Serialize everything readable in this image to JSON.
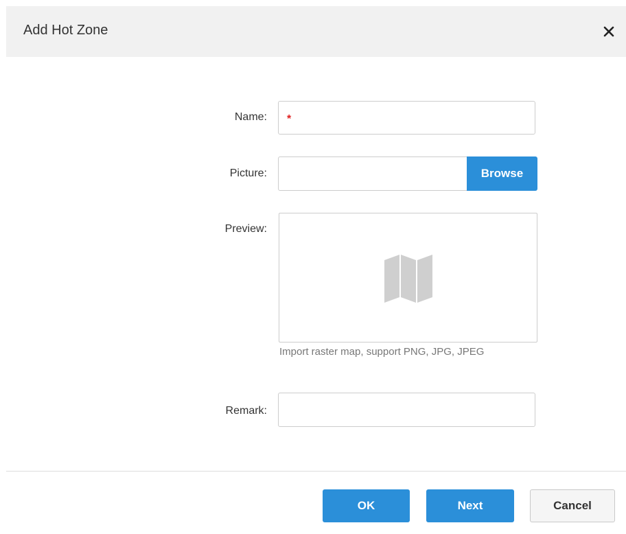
{
  "dialog": {
    "title": "Add Hot Zone",
    "close_icon": "close-icon"
  },
  "form": {
    "name": {
      "label": "Name:",
      "value": "",
      "required_marker": "*"
    },
    "picture": {
      "label": "Picture:",
      "value": "",
      "browse_label": "Browse"
    },
    "preview": {
      "label": "Preview:",
      "placeholder_icon": "map-icon",
      "hint": "Import raster map, support PNG, JPG, JPEG"
    },
    "remark": {
      "label": "Remark:",
      "value": ""
    }
  },
  "footer": {
    "ok_label": "OK",
    "next_label": "Next",
    "cancel_label": "Cancel"
  },
  "colors": {
    "primary": "#2b8fd9",
    "header_bg": "#f1f1f1",
    "required": "#e02020",
    "map_icon": "#cfcfcf"
  }
}
